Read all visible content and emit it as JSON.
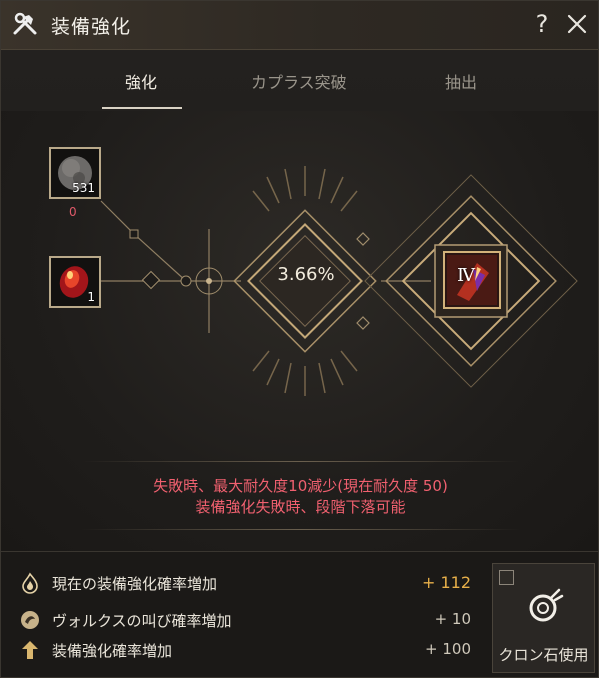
{
  "window": {
    "title": "装備強化"
  },
  "titlebar": {
    "help_label": "?",
    "icon": "hammer-wrench-icon"
  },
  "tabs": [
    {
      "label": "強化",
      "active": true
    },
    {
      "label": "カプラス突破",
      "active": false
    },
    {
      "label": "抽出",
      "active": false
    }
  ],
  "materials": {
    "stone": {
      "icon": "black-stone-icon",
      "count": "531",
      "sub": "0"
    },
    "crystal": {
      "icon": "red-crystal-icon",
      "count": "1"
    }
  },
  "enhance": {
    "chance": "3.66%",
    "target_grade": "Ⅳ",
    "target_icon": "enhance-target-gem-icon"
  },
  "warnings": [
    "失敗時、最大耐久度10減少(現在耐久度 50)",
    "装備強化失敗時、段階下落可能"
  ],
  "bonus": {
    "total": {
      "label": "現在の装備強化確率増加",
      "value": "+ 112",
      "icon": "flame-icon"
    },
    "items": [
      {
        "label": "ヴォルクスの叫び確率増加",
        "value": "+ 10",
        "icon": "vell-cry-icon"
      },
      {
        "label": "装備強化確率増加",
        "value": "+ 100",
        "icon": "up-arrow-icon"
      }
    ]
  },
  "cron": {
    "label": "クロン石使用",
    "icon": "cron-stone-icon",
    "checked": false
  },
  "colors": {
    "accent_gold": "#e8b04a",
    "warning_red": "#f0606f",
    "frame_gold": "#b9a98a"
  }
}
